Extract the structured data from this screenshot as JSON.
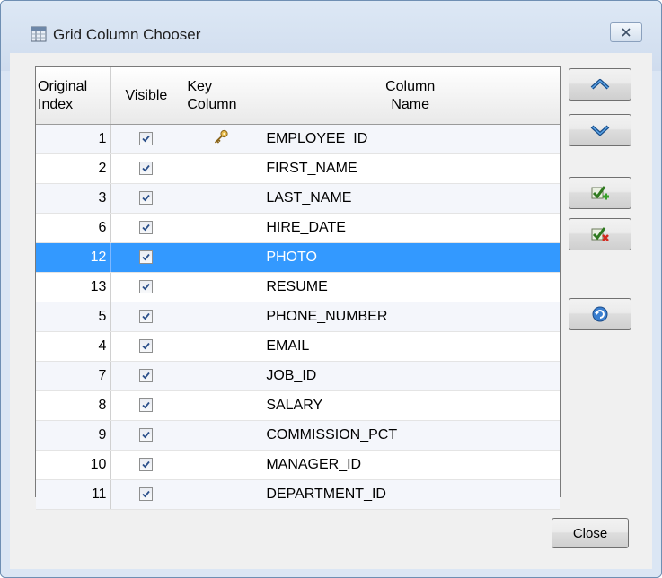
{
  "window": {
    "title": "Grid Column Chooser",
    "accent": "#3399ff"
  },
  "grid": {
    "headers": {
      "original_index": [
        "Original",
        "Index"
      ],
      "visible": "Visible",
      "key_column": [
        "Key",
        "Column"
      ],
      "column_name": [
        "Column",
        "Name"
      ]
    },
    "rows": [
      {
        "index": "1",
        "visible": true,
        "key": true,
        "name": "EMPLOYEE_ID"
      },
      {
        "index": "2",
        "visible": true,
        "key": false,
        "name": "FIRST_NAME"
      },
      {
        "index": "3",
        "visible": true,
        "key": false,
        "name": "LAST_NAME"
      },
      {
        "index": "6",
        "visible": true,
        "key": false,
        "name": "HIRE_DATE"
      },
      {
        "index": "12",
        "visible": true,
        "key": false,
        "name": "PHOTO",
        "selected": true
      },
      {
        "index": "13",
        "visible": true,
        "key": false,
        "name": "RESUME"
      },
      {
        "index": "5",
        "visible": true,
        "key": false,
        "name": "PHONE_NUMBER"
      },
      {
        "index": "4",
        "visible": true,
        "key": false,
        "name": "EMAIL"
      },
      {
        "index": "7",
        "visible": true,
        "key": false,
        "name": "JOB_ID"
      },
      {
        "index": "8",
        "visible": true,
        "key": false,
        "name": "SALARY"
      },
      {
        "index": "9",
        "visible": true,
        "key": false,
        "name": "COMMISSION_PCT"
      },
      {
        "index": "10",
        "visible": true,
        "key": false,
        "name": "MANAGER_ID"
      },
      {
        "index": "11",
        "visible": true,
        "key": false,
        "name": "DEPARTMENT_ID"
      }
    ]
  },
  "side_buttons": {
    "move_up": "chevron-up-icon",
    "move_down": "chevron-down-icon",
    "check_all": "check-add-icon",
    "uncheck_all": "check-remove-icon",
    "reset": "reset-icon"
  },
  "footer": {
    "close_label": "Close"
  }
}
